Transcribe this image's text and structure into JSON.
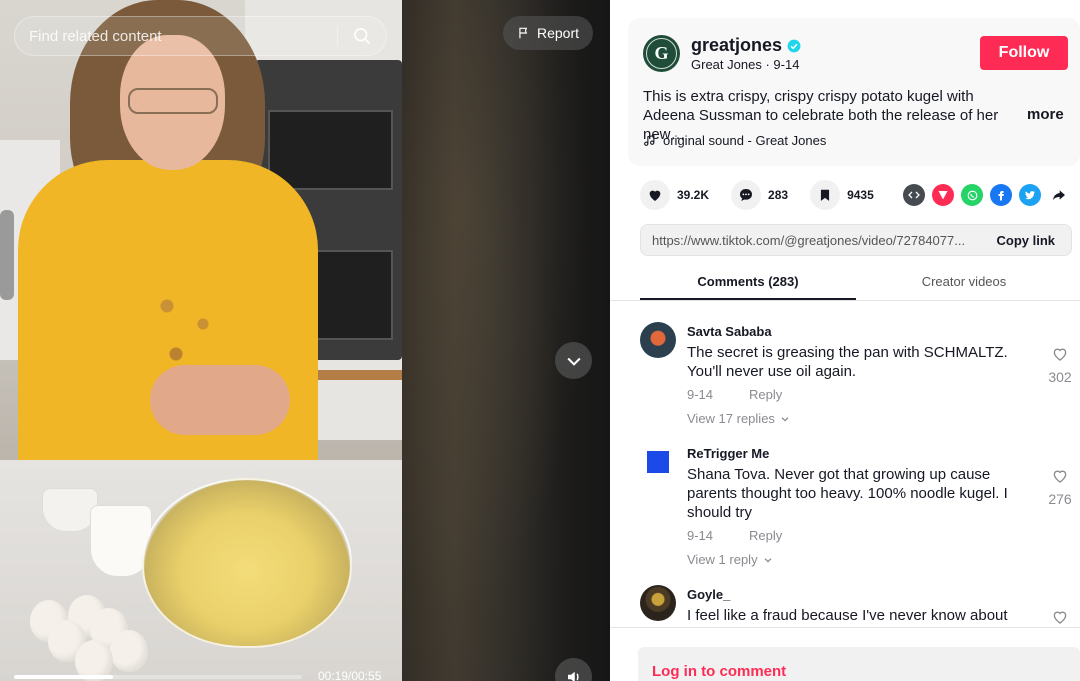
{
  "video": {
    "search_placeholder": "Find related content",
    "report_label": "Report",
    "time": "00:19/00:55",
    "progress_fraction": 0.345
  },
  "author": {
    "username": "greatjones",
    "avatar_initial": "G",
    "display_name": "Great Jones",
    "separator": "·",
    "date": "9-14",
    "follow_label": "Follow",
    "description": "This is extra crispy, crispy crispy potato kugel with Adeena Sussman to celebrate both the release of her new…",
    "more_label": "more",
    "sound": "original sound - Great Jones"
  },
  "stats": {
    "likes": "39.2K",
    "comments": "283",
    "saves": "9435"
  },
  "share": {
    "url": "https://www.tiktok.com/@greatjones/video/72784077...",
    "copy_label": "Copy link"
  },
  "tabs": [
    {
      "label": "Comments (283)",
      "active": true
    },
    {
      "label": "Creator videos",
      "active": false
    }
  ],
  "comments": [
    {
      "name": "Savta Sababa",
      "text": "The secret is greasing the pan with SCHMALTZ. You'll never use oil again.",
      "date": "9-14",
      "reply_label": "Reply",
      "view_replies": "View 17 replies",
      "likes": "302"
    },
    {
      "name": "ReTrigger Me",
      "text": "Shana Tova. Never got that growing up cause parents thought too heavy. 100% noodle kugel. I should try",
      "date": "9-14",
      "reply_label": "Reply",
      "view_replies": "View 1 reply",
      "likes": "276"
    },
    {
      "name": "Goyle_",
      "text": "I feel like a fraud because I've never know about",
      "date": "",
      "reply_label": "",
      "view_replies": "",
      "likes": ""
    }
  ],
  "footer": {
    "login_label": "Log in to comment"
  },
  "colors": {
    "brand_red": "#fe2c55",
    "verified_blue": "#20d5ec",
    "author_avatar": "#1f4d3a"
  },
  "icons": {
    "search": "search-icon",
    "report": "flag-icon",
    "down": "chevron-down-icon",
    "volume": "volume-icon",
    "verified": "verified-badge-icon",
    "music": "music-note-icon",
    "like": "heart-icon",
    "comment": "comment-icon",
    "save": "bookmark-icon",
    "embed": "embed-icon",
    "send": "send-icon",
    "whatsapp": "whatsapp-icon",
    "facebook": "facebook-icon",
    "twitter": "twitter-icon",
    "share": "share-arrow-icon"
  }
}
